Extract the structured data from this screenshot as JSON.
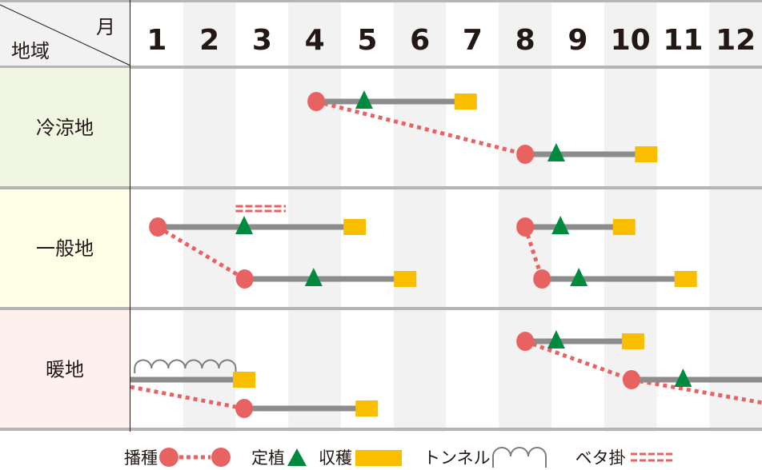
{
  "header": {
    "month_label": "月",
    "region_label": "地域",
    "months": [
      "1",
      "2",
      "3",
      "4",
      "5",
      "6",
      "7",
      "8",
      "9",
      "10",
      "11",
      "12"
    ]
  },
  "colors": {
    "sow": "#e96262",
    "plant": "#008a3e",
    "harvest": "#fabe00",
    "growth_line": "#8c8c8c",
    "tunnel": "#7d7d7d",
    "beta": "#e96262",
    "row_bg": [
      "#f1f6e3",
      "#fefde6",
      "#fdf0ed"
    ],
    "stripe": "#f2f2f2",
    "header_bg": "#f2f2f2",
    "divider": "#b5b5b5"
  },
  "rows": [
    {
      "label": "冷涼地",
      "plans": [
        {
          "lane": 0,
          "sow": 4.53,
          "plant": 5.44,
          "harvest": 7.37
        },
        {
          "lane": 1,
          "sow": 8.5,
          "plant": 9.09,
          "harvest": 10.8
        }
      ],
      "links": [
        {
          "from": [
            4.53,
            0
          ],
          "to": [
            8.5,
            1
          ]
        }
      ]
    },
    {
      "label": "一般地",
      "plans": [
        {
          "lane": 0,
          "sow": 1.52,
          "plant": 3.16,
          "harvest": 5.26,
          "beta": [
            3.0,
            3.95
          ]
        },
        {
          "lane": 1,
          "sow": 3.17,
          "plant": 4.48,
          "harvest": 6.22
        },
        {
          "lane": 0,
          "sow": 8.5,
          "plant": 9.17,
          "harvest": 10.38
        },
        {
          "lane": 1,
          "sow": 8.82,
          "plant": 9.52,
          "harvest": 11.55
        }
      ],
      "links": [
        {
          "from": [
            1.52,
            0
          ],
          "to": [
            3.17,
            1
          ]
        },
        {
          "from": [
            8.5,
            0
          ],
          "to": [
            8.82,
            1
          ]
        }
      ]
    },
    {
      "label": "暖地",
      "plans": [
        {
          "lane": 1,
          "line_start": 1.0,
          "harvest": 3.16,
          "tunnel": [
            1.08,
            3.0
          ]
        },
        {
          "lane": 2,
          "sow": 3.16,
          "harvest": 5.49
        },
        {
          "lane": 0,
          "sow": 8.5,
          "plant": 9.09,
          "harvest": 10.55
        },
        {
          "lane": 1,
          "sow": 10.52,
          "plant": 11.5,
          "line_end": 13.0
        }
      ],
      "links": [
        {
          "from": [
            1.0,
            1.25
          ],
          "to": [
            3.16,
            2
          ]
        },
        {
          "from": [
            8.5,
            0
          ],
          "to": [
            10.52,
            1
          ]
        },
        {
          "from": [
            10.52,
            1
          ],
          "to": [
            13.0,
            1.8
          ]
        }
      ]
    }
  ],
  "legend": {
    "sow": "播種",
    "plant": "定植",
    "harvest": "収穫",
    "tunnel": "トンネル",
    "beta": "ベタ掛"
  }
}
